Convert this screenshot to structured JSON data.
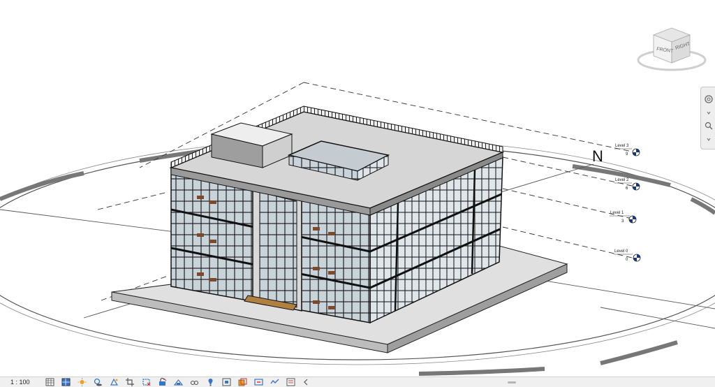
{
  "view": {
    "scale": "1 : 100",
    "north_label": "N"
  },
  "viewcube": {
    "front_label": "FRONT",
    "right_label": "RIGHT"
  },
  "levels": [
    {
      "name": "Level 3",
      "elevation": "9"
    },
    {
      "name": "Level 2",
      "elevation": "6"
    },
    {
      "name": "Level 1",
      "elevation": "3"
    },
    {
      "name": "Level 0",
      "elevation": "0"
    }
  ],
  "navigation_bar": {
    "tools": [
      "steering-wheel-icon",
      "zoom-icon",
      "chevron-icon"
    ]
  },
  "view_control_bar": {
    "tools": [
      "detail-level-icon",
      "visual-style-icon",
      "sun-path-icon",
      "shadows-icon",
      "render-icon",
      "crop-view-icon",
      "show-crop-region-icon",
      "unlock-3d-view-icon",
      "temporary-hide-icon",
      "reveal-hidden-icon",
      "worksharing-display-icon",
      "analytical-model-icon",
      "highlight-displacement-icon",
      "reveal-constraints-icon",
      "show-analytical-icon",
      "view-properties-icon"
    ],
    "colors": {
      "blue": "#3b74c4",
      "orange": "#f0a020",
      "red": "#d03030",
      "gray": "#555555"
    }
  }
}
